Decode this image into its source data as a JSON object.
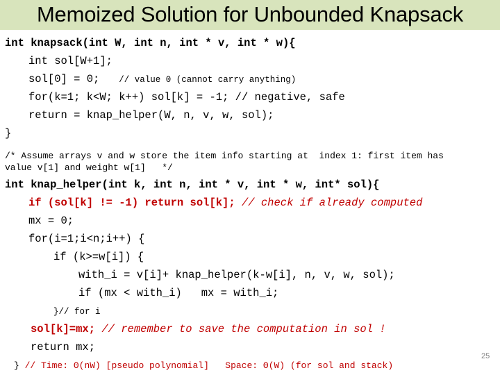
{
  "slide": {
    "title": "Memoized Solution for Unbounded Knapsack",
    "page_number": "25",
    "colors": {
      "title_band": "#d8e4bc",
      "highlight": "#c00000",
      "text": "#000000",
      "page_number": "#808080"
    }
  },
  "code": {
    "knapsack_signature": "int knapsack(int W, int n, int * v, int * w){",
    "sol_decl": "int sol[W+1];",
    "sol0_code": "sol[0] = 0;",
    "sol0_comment": "// value 0 (cannot carry anything)",
    "for_init": "for(k=1; k<W; k++) sol[k] = -1; // negative, safe",
    "return_helper": "return = knap_helper(W, n, v, w, sol);",
    "close_brace_1": "}",
    "assume_comment_1": "/* Assume arrays v and w store the item info starting at  index 1: first item has",
    "assume_comment_2": "value v[1] and weight w[1]   */",
    "helper_signature": "int knap_helper(int k, int n, int * v, int * w, int* sol){",
    "check_code": "if (sol[k] != -1) return sol[k];",
    "check_comment": "// check if already computed",
    "mx_init": "mx = 0;",
    "for_loop": "for(i=1;i<n;i++) {",
    "if_weight": "if (k>=w[i]) {",
    "with_i": "with_i = v[i]+ knap_helper(k-w[i], n, v, w, sol);",
    "if_mx": "if (mx < with_i)   mx = with_i;",
    "end_for": "}// for i",
    "save_code": "sol[k]=mx;",
    "save_comment": "// remember to save the computation in sol !",
    "return_mx": "return mx;",
    "close_brace_2": "}",
    "complexity_time": "// Time: Θ(nW) [pseudo polynomial]",
    "complexity_space": "Space: Θ(W) (for sol and stack)"
  }
}
